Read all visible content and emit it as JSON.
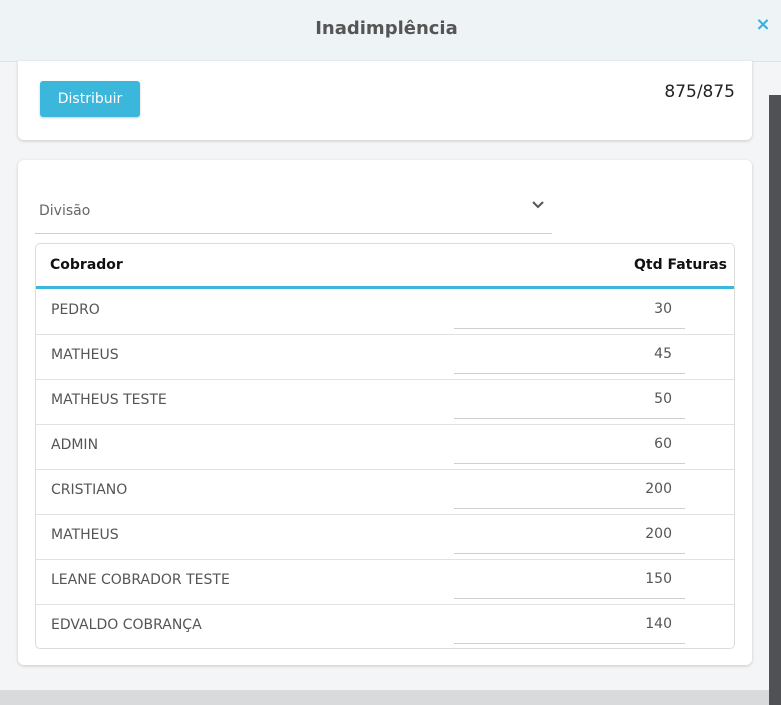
{
  "modal": {
    "title": "Inadimplência",
    "close_icon": "×"
  },
  "toolbar": {
    "distribute_label": "Distribuir",
    "counter": "875/875"
  },
  "filter": {
    "division_placeholder": "Divisão"
  },
  "table": {
    "headers": {
      "collector": "Cobrador",
      "invoice_count": "Qtd Faturas"
    },
    "rows": [
      {
        "name": "PEDRO",
        "qty": "30"
      },
      {
        "name": "MATHEUS",
        "qty": "45"
      },
      {
        "name": "MATHEUS TESTE",
        "qty": "50"
      },
      {
        "name": "ADMIN",
        "qty": "60"
      },
      {
        "name": "CRISTIANO",
        "qty": "200"
      },
      {
        "name": "MATHEUS",
        "qty": "200"
      },
      {
        "name": "LEANE COBRADOR TESTE",
        "qty": "150"
      },
      {
        "name": "EDVALDO COBRANÇA",
        "qty": "140"
      }
    ]
  },
  "colors": {
    "accent": "#3ab7db",
    "header_bg": "#eef3f6"
  }
}
